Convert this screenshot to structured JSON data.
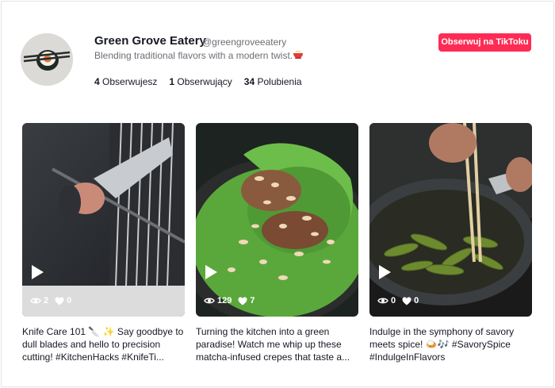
{
  "profile": {
    "name": "Green Grove Eatery",
    "handle": "@greengroveeatery",
    "bio": "Blending traditional flavors with a modern twist.",
    "stats": [
      {
        "value": "4",
        "label": "Obserwujesz"
      },
      {
        "value": "1",
        "label": "Obserwujący"
      },
      {
        "value": "34",
        "label": "Polubienia"
      }
    ],
    "follow_label": "Obserwuj na TikToku"
  },
  "videos": [
    {
      "views": "2",
      "likes": "0",
      "caption": "Knife Care 101 🔪 ✨ Say goodbye to dull blades and hello to precision cutting! #KitchenHacks #KnifeTi..."
    },
    {
      "views": "129",
      "likes": "7",
      "caption": "Turning the kitchen into a green paradise! Watch me whip up these matcha-infused crepes that taste a..."
    },
    {
      "views": "0",
      "likes": "0",
      "caption": "Indulge in the symphony of savory meets spice! 🍛🎶 #SavorySpice #IndulgeInFlavors"
    }
  ],
  "colors": {
    "accent": "#fe2c55",
    "text": "#161823",
    "muted": "#6d6e75"
  }
}
